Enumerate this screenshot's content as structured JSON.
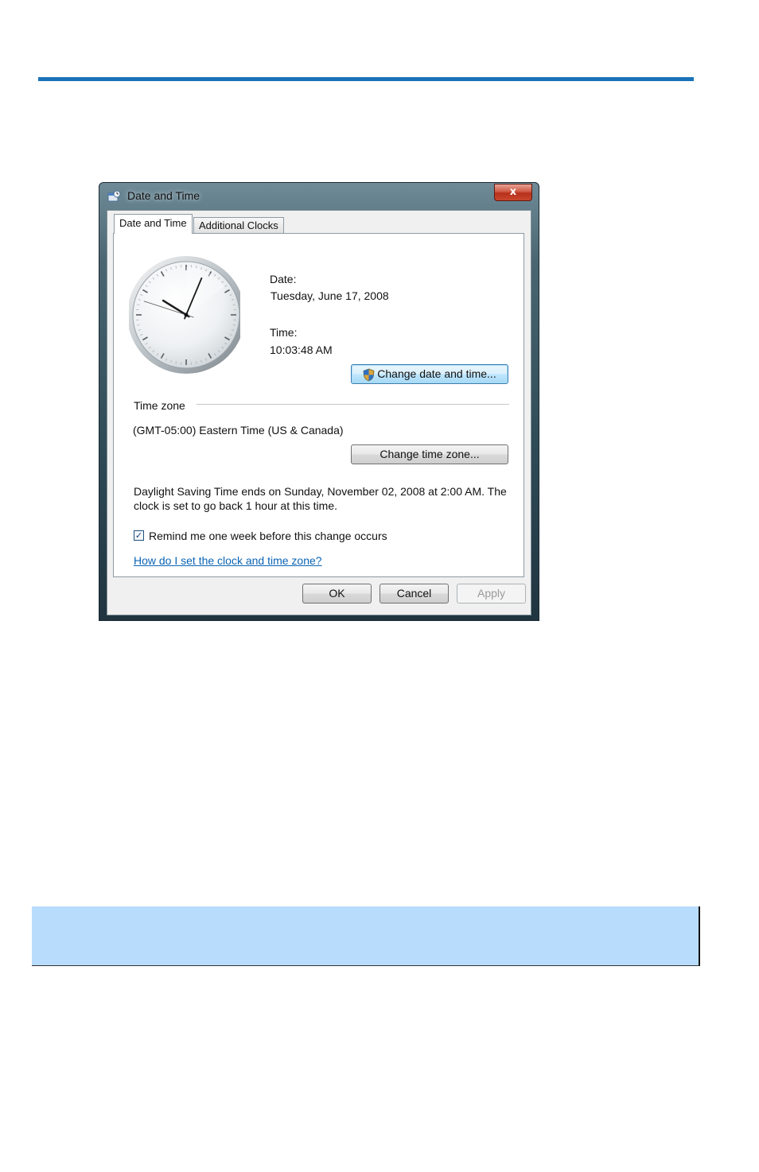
{
  "window": {
    "title": "Date and Time",
    "close_glyph": "x"
  },
  "tabs": [
    {
      "label": "Date and Time",
      "active": true
    },
    {
      "label": "Additional Clocks",
      "active": false
    }
  ],
  "clock": {
    "hour": 10,
    "minute": 3,
    "second": 48
  },
  "date_section": {
    "date_label": "Date:",
    "date_value": "Tuesday, June 17, 2008",
    "time_label": "Time:",
    "time_value": "10:03:48 AM",
    "change_button": "Change date and time..."
  },
  "timezone_section": {
    "header": "Time zone",
    "value": "(GMT-05:00) Eastern Time (US & Canada)",
    "change_button": "Change time zone...",
    "dst_line1": "Daylight Saving Time ends on Sunday, November 02, 2008 at 2:00 AM. The",
    "dst_line2": "clock is set to go back 1 hour at this time.",
    "remind_checkbox_label": "Remind me one week before this change occurs",
    "remind_checked": true,
    "help_link": "How do I set the clock and time zone?"
  },
  "footer": {
    "ok": "OK",
    "cancel": "Cancel",
    "apply": "Apply"
  },
  "colors": {
    "top_rule": "#1a73b8",
    "note_bar": "#b8dcfb",
    "link": "#0a64b4"
  }
}
